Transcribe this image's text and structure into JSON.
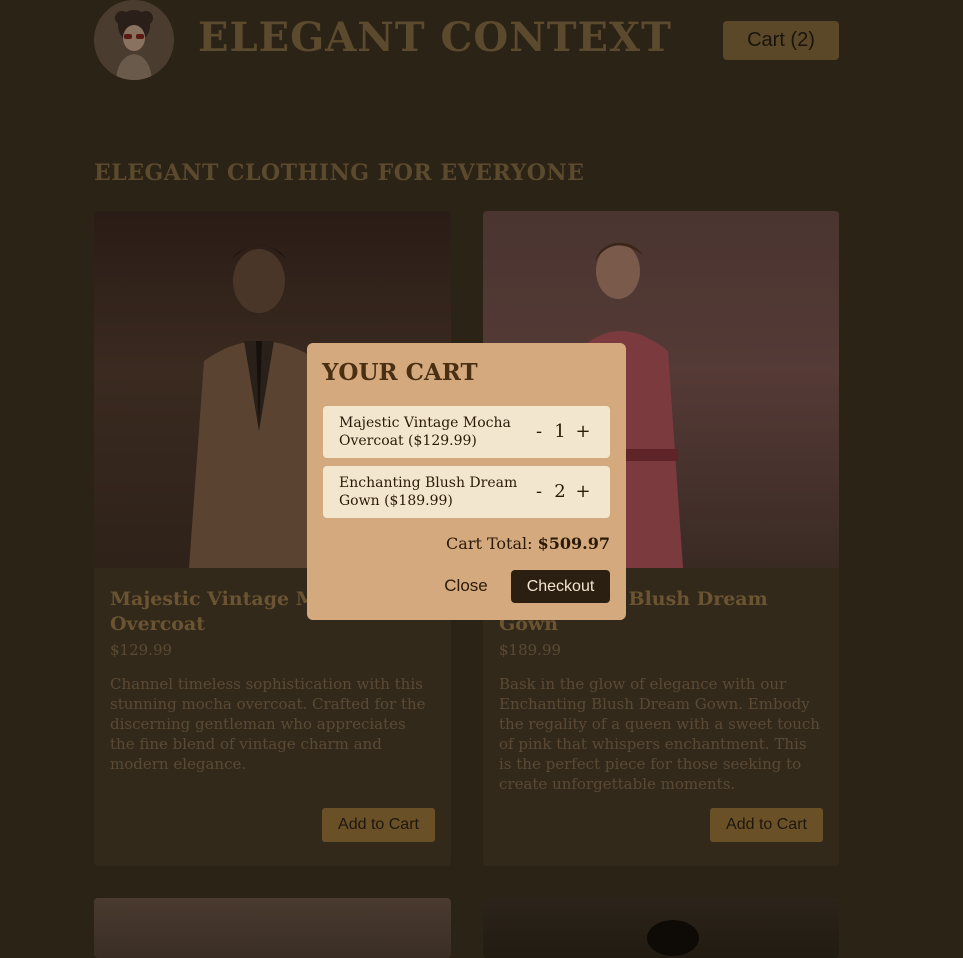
{
  "header": {
    "brand": "ELEGANT CONTEXT",
    "cart_button": "Cart (2)",
    "logo_icon": "vintage-woman-avatar-icon"
  },
  "main": {
    "section_title": "ELEGANT CLOTHING FOR EVERYONE",
    "products": [
      {
        "title": "Majestic Vintage Mocha Overcoat",
        "price": "$129.99",
        "description": "Channel timeless sophistication with this stunning mocha overcoat. Crafted for the discerning gentleman who appreciates the fine blend of vintage charm and modern elegance.",
        "add_label": "Add to Cart"
      },
      {
        "title": "Enchanting Blush Dream Gown",
        "price": "$189.99",
        "description": "Bask in the glow of elegance with our Enchanting Blush Dream Gown. Embody the regality of a queen with a sweet touch of pink that whispers enchantment. This is the perfect piece for those seeking to create unforgettable moments.",
        "add_label": "Add to Cart"
      }
    ]
  },
  "cart_modal": {
    "title": "YOUR CART",
    "items": [
      {
        "name": "Majestic Vintage Mocha Overcoat ($129.99)",
        "minus": "-",
        "qty": "1",
        "plus": "+"
      },
      {
        "name": "Enchanting Blush Dream Gown ($189.99)",
        "minus": "-",
        "qty": "2",
        "plus": "+"
      }
    ],
    "total_label": "Cart Total:",
    "total_value": "$509.97",
    "close_label": "Close",
    "checkout_label": "Checkout"
  },
  "colors": {
    "overlay_bg": "#2b2315",
    "modal_bg": "#d4a97d",
    "item_bg": "#f3e6cf",
    "checkout_bg": "#2a1f10"
  }
}
